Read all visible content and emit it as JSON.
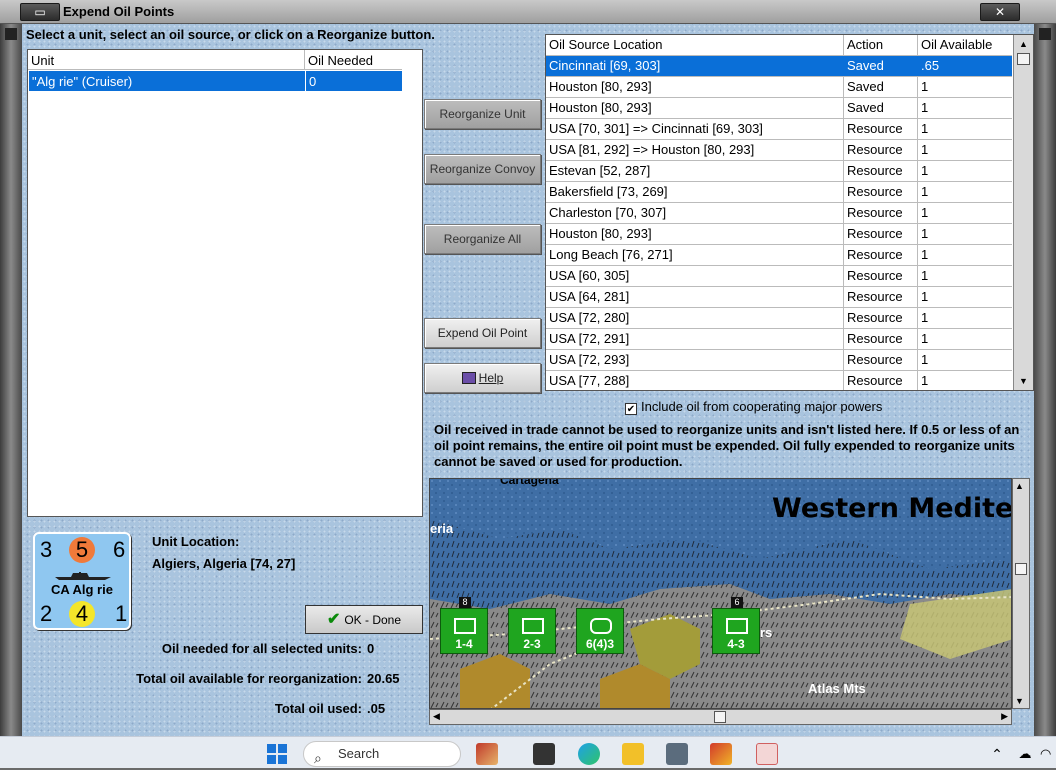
{
  "window": {
    "title": "Expend Oil Points",
    "close_glyph": "✕",
    "restore_glyph": "▭"
  },
  "instructions": "Select a unit, select an oil source, or click on a Reorganize button.",
  "units_table": {
    "headers": [
      "Unit",
      "Oil Needed"
    ],
    "rows": [
      {
        "unit": "\"Alg rie\" (Cruiser)",
        "oil_needed": "0"
      }
    ]
  },
  "buttons": {
    "reorganize_unit": "Reorganize Unit",
    "reorganize_convoy": "Reorganize Convoy",
    "reorganize_all": "Reorganize All",
    "expend_oil_point": "Expend Oil Point",
    "help": "Help",
    "ok_done": "OK - Done"
  },
  "oil_table": {
    "headers": [
      "Oil Source Location",
      "Action",
      "Oil Available"
    ],
    "rows": [
      {
        "location": "Cincinnati [69, 303]",
        "action": "Saved",
        "available": ".65",
        "selected": true
      },
      {
        "location": "Houston [80, 293]",
        "action": "Saved",
        "available": "1"
      },
      {
        "location": "Houston [80, 293]",
        "action": "Saved",
        "available": "1"
      },
      {
        "location": "USA [70, 301] => Cincinnati [69, 303]",
        "action": "Resource",
        "available": "1"
      },
      {
        "location": "USA [81, 292] => Houston [80, 293]",
        "action": "Resource",
        "available": "1"
      },
      {
        "location": "Estevan [52, 287]",
        "action": "Resource",
        "available": "1"
      },
      {
        "location": "Bakersfield [73, 269]",
        "action": "Resource",
        "available": "1"
      },
      {
        "location": "Charleston [70, 307]",
        "action": "Resource",
        "available": "1"
      },
      {
        "location": "Houston [80, 293]",
        "action": "Resource",
        "available": "1"
      },
      {
        "location": "Long Beach [76, 271]",
        "action": "Resource",
        "available": "1"
      },
      {
        "location": "USA [60, 305]",
        "action": "Resource",
        "available": "1"
      },
      {
        "location": "USA [64, 281]",
        "action": "Resource",
        "available": "1"
      },
      {
        "location": "USA [72, 280]",
        "action": "Resource",
        "available": "1"
      },
      {
        "location": "USA [72, 291]",
        "action": "Resource",
        "available": "1"
      },
      {
        "location": "USA [72, 293]",
        "action": "Resource",
        "available": "1"
      },
      {
        "location": "USA [77, 288]",
        "action": "Resource",
        "available": "1"
      }
    ]
  },
  "include_oil_checkbox": {
    "label": "Include oil from cooperating major powers",
    "checked": true
  },
  "notice": "Oil received in trade cannot be used to reorganize units and isn't listed here.  If 0.5 or less of an oil point remains, the entire oil point must be expended.   Oil fully expended to reorganize units cannot be saved or used for production.",
  "map": {
    "title": "Western Mediter",
    "labels": [
      "Cartagena",
      "eria",
      "rs",
      "Atlas Mts"
    ],
    "counters": [
      {
        "value": "1-4",
        "stack": "8"
      },
      {
        "value": "2-3",
        "stack": ""
      },
      {
        "value": "6(4)3",
        "stack": ""
      },
      {
        "value": "4-3",
        "stack": "6"
      }
    ]
  },
  "unit_counter": {
    "top_left": "3",
    "top_mid": "5",
    "top_right": "6",
    "name": "CA Alg rie",
    "bot_left": "2",
    "bot_mid": "4",
    "bot_right": "1"
  },
  "unit_location": {
    "label": "Unit Location:",
    "value": "Algiers, Algeria [74, 27]"
  },
  "stats": {
    "oil_needed_label": "Oil needed for all selected units:",
    "oil_needed_value": "0",
    "total_available_label": "Total oil available for reorganization:",
    "total_available_value": "20.65",
    "total_used_label": "Total oil used:",
    "total_used_value": ".05"
  },
  "taskbar": {
    "search_label": "Search"
  }
}
